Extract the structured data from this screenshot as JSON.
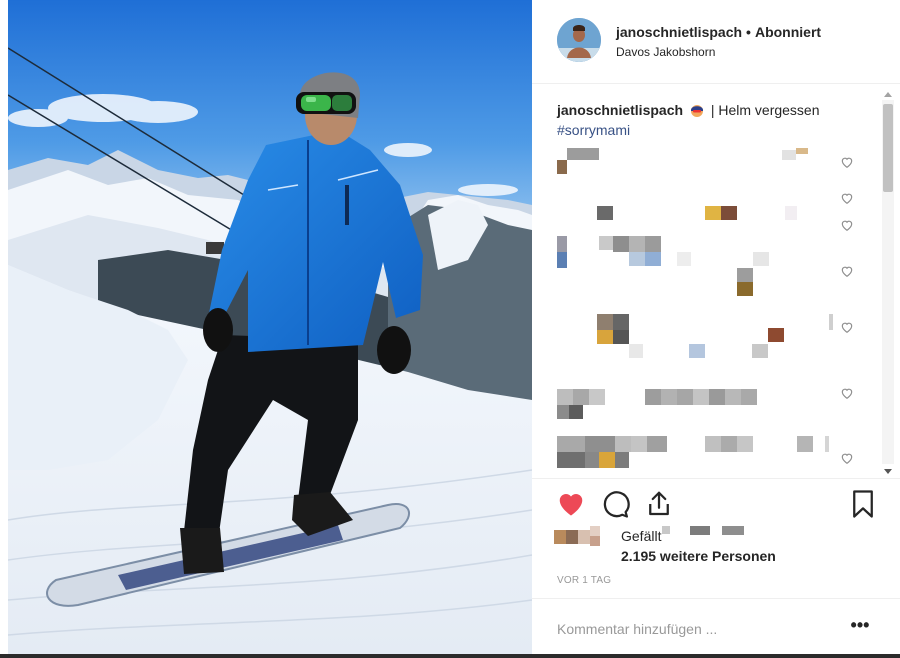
{
  "post": {
    "username": "janoschnietlispach",
    "separator": "•",
    "follow_status": "Abonniert",
    "location": "Davos Jakobshorn",
    "caption_user": "janoschnietlispach",
    "caption_text": "| Helm vergessen",
    "caption_hashtag": "#sorrymami",
    "liked_by_prefix": "Gefällt",
    "liked_by_count": "2.195 weitere Personen",
    "timestamp": "VOR 1 TAG",
    "comment_placeholder": "Kommentar hinzufügen ...",
    "more_label": "•••"
  },
  "icons": {
    "like": "heart-filled-icon",
    "comment": "comment-bubble-icon",
    "share": "share-upload-icon",
    "save": "bookmark-icon",
    "comment_like": "heart-outline-icon"
  },
  "colors": {
    "like_red": "#ed4956",
    "link_blue": "#385185",
    "text": "#262626",
    "muted": "#999999"
  },
  "photo": {
    "description_tags": [
      "snowboarder",
      "blue-jacket",
      "mountains",
      "ski-lift"
    ]
  }
}
